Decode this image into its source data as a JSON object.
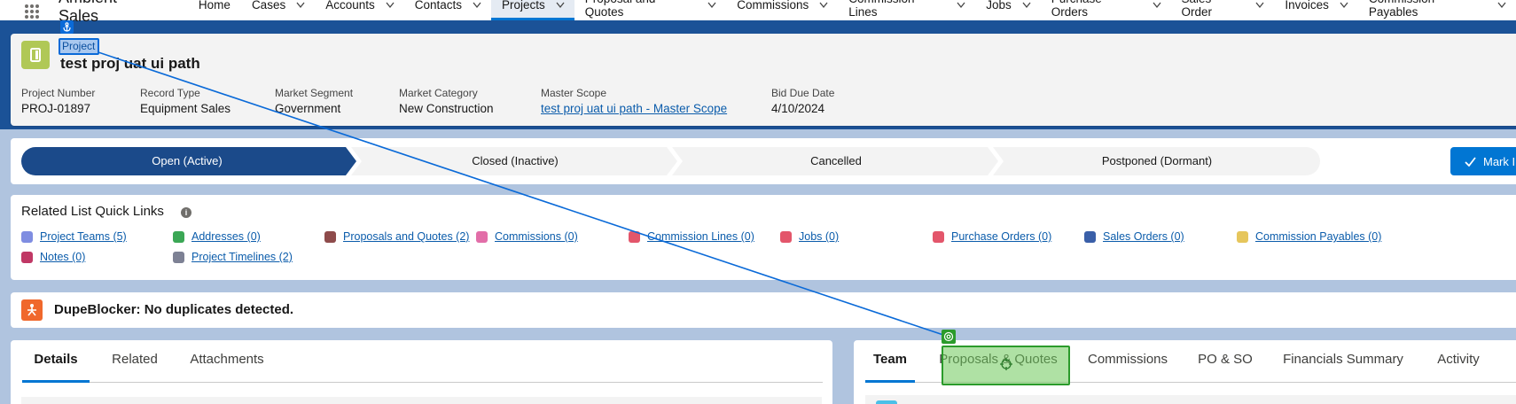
{
  "app": {
    "name": "Ambient Sales",
    "nav": [
      {
        "label": "Home",
        "has_menu": false
      },
      {
        "label": "Cases",
        "has_menu": true
      },
      {
        "label": "Accounts",
        "has_menu": true
      },
      {
        "label": "Contacts",
        "has_menu": true
      },
      {
        "label": "Projects",
        "has_menu": true,
        "active": true
      },
      {
        "label": "Proposal and Quotes",
        "has_menu": true
      },
      {
        "label": "Commissions",
        "has_menu": true
      },
      {
        "label": "Commission Lines",
        "has_menu": true
      },
      {
        "label": "Jobs",
        "has_menu": true
      },
      {
        "label": "Purchase Orders",
        "has_menu": true
      },
      {
        "label": "Sales Order",
        "has_menu": true
      },
      {
        "label": "Invoices",
        "has_menu": true
      },
      {
        "label": "Commission Payables",
        "has_menu": true
      }
    ]
  },
  "record": {
    "object_type": "Project",
    "title": "test proj uat ui path",
    "icon": "project-icon",
    "fields": [
      {
        "label": "Project Number",
        "value": "PROJ-01897",
        "link": false
      },
      {
        "label": "Record Type",
        "value": "Equipment Sales",
        "link": false
      },
      {
        "label": "Market Segment",
        "value": "Government",
        "link": false
      },
      {
        "label": "Market Category",
        "value": "New Construction",
        "link": false
      },
      {
        "label": "Master Scope",
        "value": "test proj uat ui path - Master Scope",
        "link": true
      },
      {
        "label": "Bid Due Date",
        "value": "4/10/2024",
        "link": false
      }
    ]
  },
  "path": {
    "stages": [
      "Open (Active)",
      "Closed (Inactive)",
      "Cancelled",
      "Postponed (Dormant)"
    ],
    "active_index": 0,
    "mark_button": "Mark I"
  },
  "quick_links": {
    "title": "Related List Quick Links",
    "items": [
      {
        "label": "Project Teams (5)",
        "icon": "team-icon",
        "color": "#7f8de1"
      },
      {
        "label": "Addresses (0)",
        "icon": "address-icon",
        "color": "#3ba755"
      },
      {
        "label": "Proposals and Quotes (2)",
        "icon": "proposal-icon",
        "color": "#8e4b4b"
      },
      {
        "label": "Commissions (0)",
        "icon": "commission-icon",
        "color": "#e26ea8"
      },
      {
        "label": "Commission Lines (0)",
        "icon": "commission-lines-icon",
        "color": "#e3566b"
      },
      {
        "label": "Jobs (0)",
        "icon": "jobs-icon",
        "color": "#e3566b"
      },
      {
        "label": "Purchase Orders (0)",
        "icon": "purchase-order-icon",
        "color": "#e3566b"
      },
      {
        "label": "Sales Orders (0)",
        "icon": "sales-order-icon",
        "color": "#3a5fa8"
      },
      {
        "label": "Commission Payables (0)",
        "icon": "payables-icon",
        "color": "#e6c65c"
      },
      {
        "label": "Notes (0)",
        "icon": "notes-icon",
        "color": "#c03865"
      },
      {
        "label": "Project Timelines (2)",
        "icon": "timeline-icon",
        "color": "#7d8194"
      }
    ]
  },
  "dupeblocker": {
    "text": "DupeBlocker: No duplicates detected."
  },
  "left_tabs": {
    "tabs": [
      "Details",
      "Related",
      "Attachments"
    ],
    "active_index": 0
  },
  "right_tabs": {
    "tabs": [
      "Team",
      "Proposals & Quotes",
      "Commissions",
      "PO & SO",
      "Financials Summary",
      "Activity"
    ],
    "active_index": 0
  },
  "annotation": {
    "anchor_label": "Project"
  },
  "colors": {
    "brand_nav": "#1b5297",
    "path_active": "#1b4a8a",
    "primary": "#0176d3",
    "link": "#0b5cab",
    "anchor": "#0a6ad8",
    "target": "#2b9b2b"
  }
}
